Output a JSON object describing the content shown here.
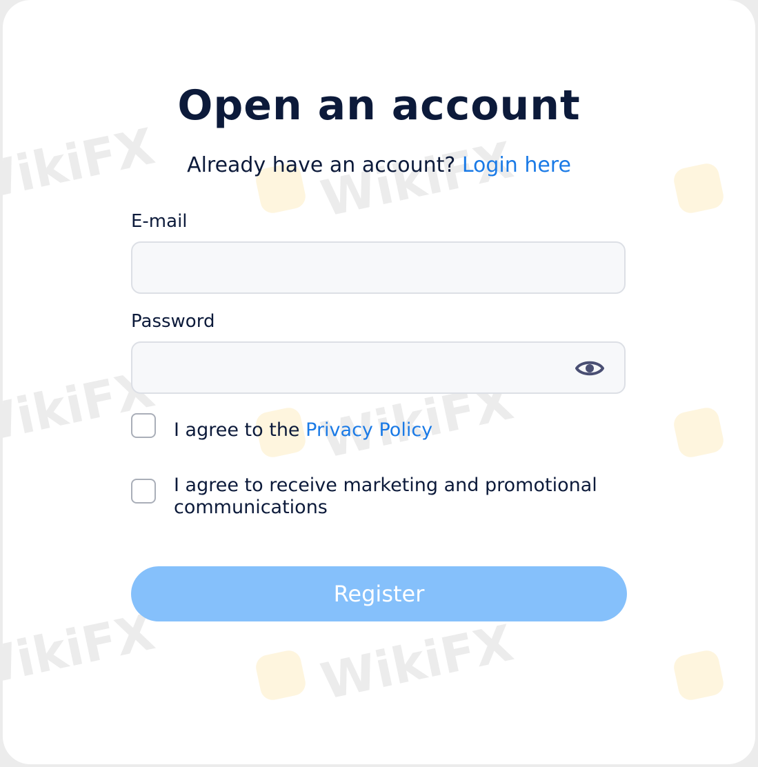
{
  "form": {
    "title": "Open an account",
    "login_prompt": "Already have an account?",
    "login_link": "Login here",
    "email_label": "E-mail",
    "email_value": "",
    "password_label": "Password",
    "password_value": "",
    "privacy_prefix": "I agree to the",
    "privacy_link": "Privacy Policy",
    "marketing_label": "I agree to receive marketing and promotional communications",
    "register_label": "Register"
  },
  "colors": {
    "title": "#0c1a3a",
    "link": "#1a7ae6",
    "button_disabled": "#85c0fb",
    "input_background": "#f7f8fa",
    "input_border": "#dcdfe5"
  },
  "icons": {
    "password_toggle": "eye-icon"
  },
  "watermark": {
    "text": "WikiFX"
  }
}
